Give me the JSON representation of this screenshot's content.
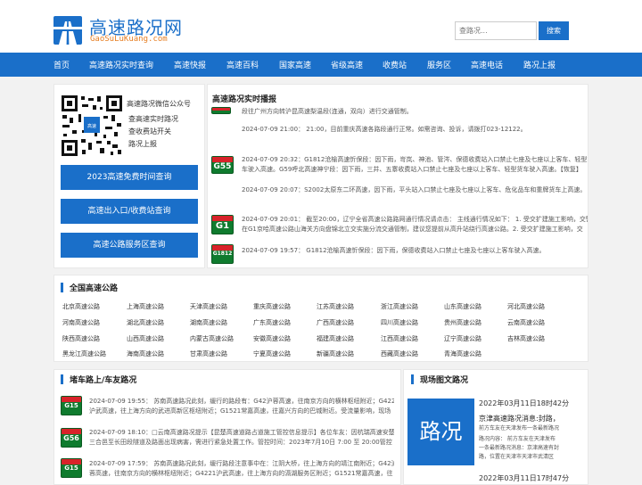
{
  "header": {
    "title": "高速路况网",
    "subtitle": "GaoSuLuKuang.com",
    "search_placeholder": "查路况...",
    "search_button": "搜索"
  },
  "nav": [
    "首页",
    "高速路况实时查询",
    "高速快报",
    "高速百科",
    "国家高速",
    "省级高速",
    "收费站",
    "服务区",
    "高速电话",
    "路况上报"
  ],
  "wechat": {
    "title": "高速路况微信公众号",
    "items": [
      "查高速实时路况",
      "查收费站开关",
      "路况上报"
    ]
  },
  "side_buttons": [
    "2023高速免费时间查询",
    "高速出入口/收费站查询",
    "高速公路服务区查询"
  ],
  "live": {
    "title": "高速路况实时播报",
    "items": [
      {
        "sign": "",
        "lines": [
          "段往广州方向转沪昆高速梨温段(连通，双向）进行交通管制。"
        ]
      },
      {
        "sign": "",
        "lines": [
          "2024-07-09 21:00： 21:00，目前重庆高速各路段通行正常。如需咨询、投诉，请拨打023-12122。"
        ]
      },
      {
        "sign": "G55",
        "lines": [
          "2024-07-09 20:32：G1812沧榆高速忻保段：因下雨，岢岚、神池、管涔、保德收费站入口禁止七座及七座以上客车、轻型货",
          "车驶入高速。G59呼北高速神宁段：因下雨，三井、五寨收费站入口禁止七座及七座以上客车、轻型货车驶入高速。【恢复】"
        ]
      },
      {
        "sign": "",
        "lines": [
          "2024-07-09 20:07：S2002太原东二环高速，因下雨，平头站入口禁止七座及七座以上客车、危化品车和重牌货车上高速。"
        ]
      },
      {
        "sign": "G1",
        "lines": [
          "2024-07-09 20:01： 截至20:00，辽宁全省高速公路路网通行情况请点击： 主线通行情况如下： 1. 受交扩建施工影响，交警",
          "在G1京哈高速公路山海关方向盘锦北立交实施分流交通管制，建议您提前从高升站绕行高速公路。2. 受交扩建施工影响，交"
        ]
      },
      {
        "sign": "G1812",
        "lines": [
          "2024-07-09 19:57： G1812沧榆高速忻保段：因下雨，保德收费站入口禁止七座及七座以上客车驶入高速。"
        ]
      }
    ]
  },
  "national": {
    "title": "全国高速公路",
    "rows": [
      [
        "北京高速公路",
        "上海高速公路",
        "天津高速公路",
        "重庆高速公路",
        "江苏高速公路",
        "浙江高速公路",
        "山东高速公路",
        "河北高速公路"
      ],
      [
        "河南高速公路",
        "湖北高速公路",
        "湖南高速公路",
        "广东高速公路",
        "广西高速公路",
        "四川高速公路",
        "贵州高速公路",
        "云南高速公路"
      ],
      [
        "陕西高速公路",
        "山西高速公路",
        "内蒙古高速公路",
        "安徽高速公路",
        "福建高速公路",
        "江西高速公路",
        "辽宁高速公路",
        "吉林高速公路"
      ],
      [
        "黑龙江高速公路",
        "海南高速公路",
        "甘肃高速公路",
        "宁夏高速公路",
        "新疆高速公路",
        "西藏高速公路",
        "青海高速公路",
        ""
      ]
    ]
  },
  "jam": {
    "title": "堵车路上/车友路况",
    "items": [
      {
        "sign": "G15",
        "lines": [
          "2024-07-09 19:55： 苏南高速路况此刻，缓行的路段有：G42沪蓉高速，往南京方向的横林枢纽附近；G4221",
          "沪武高速，往上海方向的武进高新区枢纽附近；G1521常嘉高速，往嘉兴方向的巴城附近。受流量影响，现场"
        ]
      },
      {
        "sign": "G56",
        "lines": [
          "2024-07-09 18:10：□云南高速路况提示【昆楚高速道路占道施工管控信息提示】各位车友：因杭瑞高速安楚段",
          "三合邑至长田段隧道及路面出现病害，需进行紧急处置工作。管控时间：2023年7月10日 7:00 至 20:00管控"
        ]
      },
      {
        "sign": "G15",
        "lines": [
          "2024-07-09 17:59： 苏南高速路况此刻，缓行路段注意事中在：江阴大桥，往上海方向的靖江南附近；G42沪",
          "蓉高速，往南京方向的横林枢纽附近；G4221沪武高速，往上海方向的滆湖服务区附近；G1521常嘉高速，往"
        ]
      }
    ]
  },
  "scene": {
    "title": "现场图文路况",
    "pic_label": "路况",
    "items": [
      {
        "date": "2022年03月11日18时42分",
        "headline": "京津高速路况消息:封路，",
        "lines": [
          "前方车友在天津发布一条最新路况",
          "路况内容：      前方车友在天津发布",
          "一条最新路况消息：京津高速有封",
          "路，位置在天津市天津市武清区"
        ]
      },
      {
        "date": "2022年03月11日17时47分",
        "headline": "",
        "lines": []
      }
    ]
  }
}
